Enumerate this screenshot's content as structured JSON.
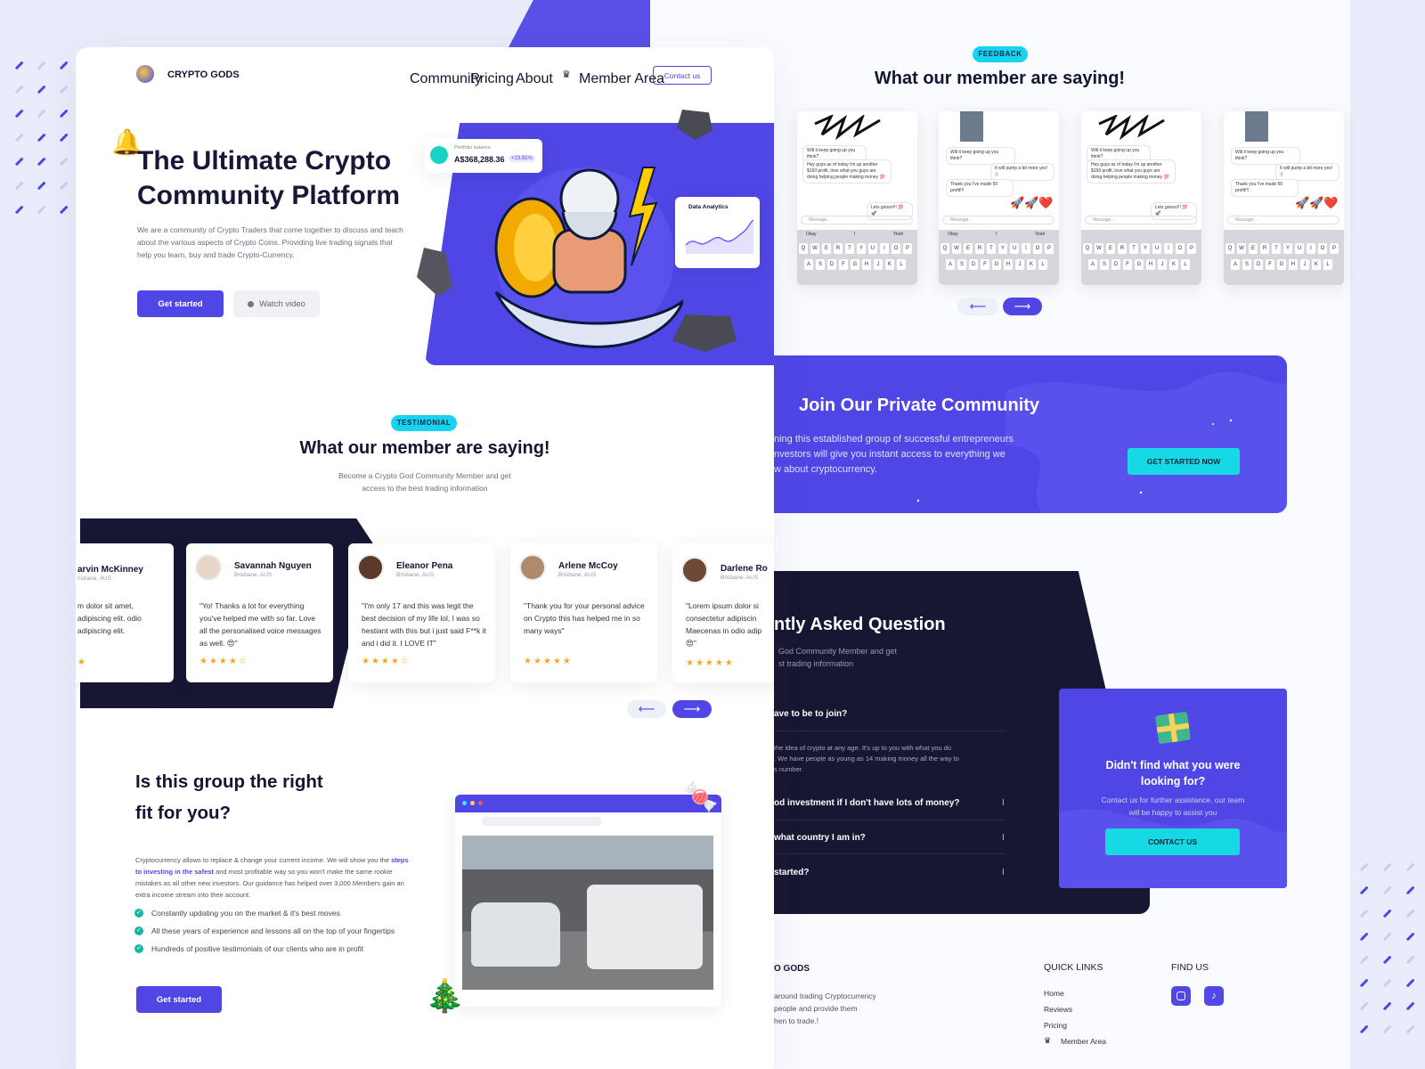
{
  "brand": {
    "name": "CRYPTO GODS",
    "footer_name": "O GODS"
  },
  "nav": {
    "community": "Community",
    "pricing": "Pricing",
    "about": "About",
    "member_area": "Member Area",
    "contact": "Contact us"
  },
  "hero": {
    "title_line1": "The Ultimate Crypto",
    "title_line2": "Community Platform",
    "desc": "We are a community of Crypto Traders that come together to discuss and teach about the various aspects of Crypto Coins. Providing live trading signals that help you learn, buy and trade Crypto-Currency.",
    "cta": "Get started",
    "watch": "Watch video",
    "portfolio_label": "Portfolio balance",
    "portfolio_value": "A$368,288.36",
    "portfolio_change": "+23.81%",
    "analytics_title": "Data Analytics"
  },
  "testimonial": {
    "pill": "TESTIMONIAL",
    "title": "What our member are saying!",
    "sub1": "Become a Crypto God Community Member and get",
    "sub2": "access to the best trading information",
    "cards": [
      {
        "name": "arvin McKinney",
        "loc": "risbane, AUS",
        "quote": "m dolor sit amet, adipiscing elit. odio adipiscing elit.",
        "stars": "★"
      },
      {
        "name": "Savannah Nguyen",
        "loc": "Brisbane, AUS",
        "quote": "\"Yo! Thanks a lot for everything you've helped me with so far. Love all the personalised voice messages as well. 😍\"",
        "stars": "★★★★☆"
      },
      {
        "name": "Eleanor Pena",
        "loc": "Brisbane, AUS",
        "quote": "\"I'm only 17 and this was legit the best decision of my life lol, I was so hestiant with this but i just said F**k it and i did it. I LOVE IT\"",
        "stars": "★★★★☆"
      },
      {
        "name": "Arlene McCoy",
        "loc": "Brisbane, AUS",
        "quote": "\"Thank you for your personal advice on Crypto this has helped me in so many ways\"",
        "stars": "★★★★★"
      },
      {
        "name": "Darlene Ro",
        "loc": "Brisbane, AUS",
        "quote": "\"Lorem ipsum dolor si consectetur adipiscin Maecenas in odio adip 😍\"",
        "stars": "★★★★★"
      }
    ],
    "prev": "⟵",
    "next": "⟶"
  },
  "fit": {
    "title_line1": "Is this group the right",
    "title_line2": "fit for you?",
    "desc_a": "Cryptocurrency allows to replace & change your current income. We will show you the",
    "desc_link": "steps to investing in the safest",
    "desc_b": "and most profitable way so you won't make the same rookie mistakes as all other new investors. Our guidance has helped over 3,000 Members gain an extra income stream into their account.",
    "points": [
      "Constantly updating you on the market & it's best moves",
      "All these years of experience and lessons all on the top of your fingertips",
      "Hundreds of positive testimonials of our clients who are in profit"
    ],
    "cta": "Get started"
  },
  "feedback": {
    "pill": "FEEDBACK",
    "title": "What our member are saying!",
    "chat_a": [
      "Will it keep going up you think?",
      "Hey guys as of today i'm up another $150 profit, love what you guys are doing helping people making money 💯",
      "Lets goooo!!! 💯🚀"
    ],
    "chat_b": [
      "Will it keep going up you think?",
      "It will pump a bit more yes! :)",
      "Thank you I've made 50 profit!!!"
    ],
    "message_placeholder": "Message...",
    "suggest": [
      "Okay",
      "I",
      "Yeah"
    ],
    "keys_row1": [
      "Q",
      "W",
      "E",
      "R",
      "T",
      "Y",
      "U",
      "I",
      "O",
      "P"
    ],
    "keys_row2": [
      "A",
      "S",
      "D",
      "F",
      "G",
      "H",
      "J",
      "K",
      "L"
    ]
  },
  "join": {
    "title": "Join Our Private Community",
    "desc1": "ning this established group of successful entrepreneurs",
    "desc2": "nvestors will give you instant access to everything we",
    "desc3": "w about cryptocurrency.",
    "cta": "GET STARTED NOW"
  },
  "faq": {
    "title": "ntly Asked Question",
    "sub1": "God Community Member and get",
    "sub2": "st trading information",
    "q1": "ave to be to join?",
    "a1a": "the idea of crypto at any age. It's up to you with what you do",
    "a1b": ". We have people as young as 14 making money all the way to",
    "a1c": "s number.",
    "q2": "od investment if I don't have lots of money?",
    "q3": "what country I am in?",
    "q4": "started?",
    "toggle": "I"
  },
  "help": {
    "title1": "Didn't find what you were",
    "title2": "looking for?",
    "desc1": "Contact us for further assistance, our team",
    "desc2": "will be happy to assist you",
    "cta": "CONTACT US"
  },
  "footer": {
    "blurb1": "around trading Cryptocurrency",
    "blurb2": "people and provide them",
    "blurb3": "hen to trade.!",
    "quick_links": "QUICK LINKS",
    "links": [
      "Home",
      "Reviews",
      "Pricing",
      "Member Area"
    ],
    "find_us": "FIND US"
  },
  "colors": {
    "primary": "#4f46e5",
    "accent": "#17d3f0",
    "dark": "#171733"
  }
}
